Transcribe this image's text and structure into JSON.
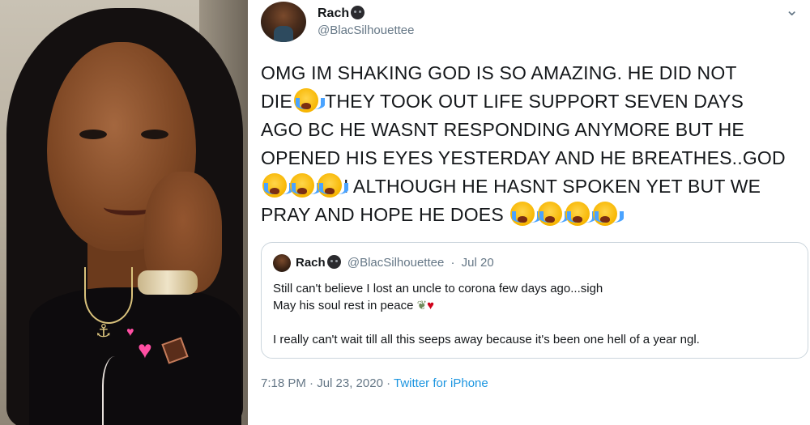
{
  "tweet": {
    "author": {
      "display_name": "Rach",
      "handle": "@BlacSilhouettee"
    },
    "menu_icon": "chevron-down",
    "text_lines": [
      {
        "before": "OMG IM SHAKING GOD IS SO AMAZING. HE DID NOT",
        "emoji_count": 0,
        "after": ""
      },
      {
        "before": "DIE",
        "emoji_count": 1,
        "after": " THEY TOOK OUT LIFE SUPPORT SEVEN DAYS"
      },
      {
        "before": "AGO BC HE WASNT RESPONDING ANYMORE BUT HE",
        "emoji_count": 0,
        "after": ""
      },
      {
        "before": "OPENED HIS EYES YESTERDAY AND HE BREATHES..GOD",
        "emoji_count": 0,
        "after": ""
      },
      {
        "before": "",
        "emoji_count": 3,
        "after": "! ALTHOUGH HE HASNT SPOKEN YET BUT WE"
      },
      {
        "before": "PRAY AND HOPE HE DOES ",
        "emoji_count": 4,
        "after": ""
      }
    ],
    "emoji_name": "loudly-crying-face",
    "quoted": {
      "display_name": "Rach",
      "handle": "@BlacSilhouettee",
      "date": "Jul 20",
      "separator": "·",
      "lines": [
        "Still can't believe I lost an uncle to corona few days ago...sigh",
        "May his soul rest in peace",
        "",
        "I really can't wait till all this seeps away because it's been one hell of a year ngl."
      ],
      "line2_emojis": [
        "herb",
        "red-heart"
      ]
    },
    "timestamp": "7:18 PM · Jul 23, 2020",
    "separator": " · ",
    "source": "Twitter for iPhone"
  },
  "photo": {
    "subject": "selfie",
    "stickers": [
      "pink-heart",
      "pink-heart",
      "chocolate"
    ]
  },
  "colors": {
    "text": "#14171a",
    "secondary": "#657786",
    "link": "#1b95e0",
    "border": "#ccd6dd"
  }
}
